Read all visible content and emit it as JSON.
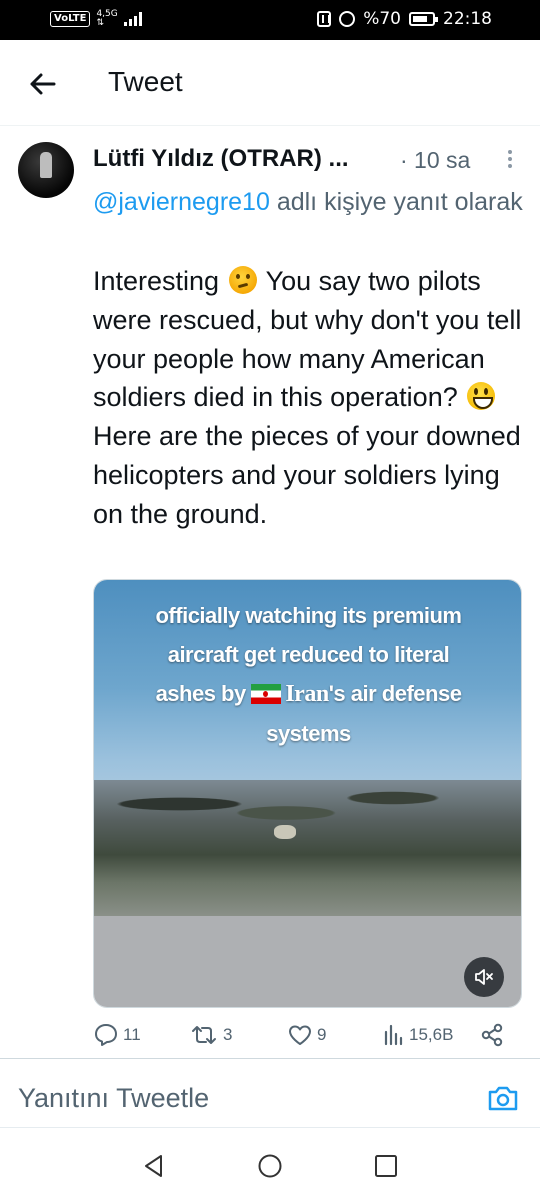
{
  "status_bar": {
    "volte": "VoLTE",
    "network_top": "4,5G",
    "network_bottom": "⇅",
    "battery_percent": "%70",
    "time": "22:18"
  },
  "header": {
    "title": "Tweet"
  },
  "tweet": {
    "author_name": "Lütfi Yıldız (OTRAR) ...",
    "time_ago": "· 10 sa",
    "reply_handle": "@javiernegre10",
    "reply_suffix": " adlı kişiye yanıt olarak",
    "text_part1": "Interesting ",
    "text_part2": " You say two pilots were rescued, but why don't you tell your people how many American soldiers died in this operation? ",
    "text_part3": "Here are the pieces of your downed helicopters and your soldiers lying on the ground.",
    "media": {
      "caption_line1": "officially watching its premium",
      "caption_line2": "aircraft get reduced to literal",
      "caption_pre": "ashes by ",
      "caption_iran": "Iran",
      "caption_post": "'s air defense",
      "caption_line4": "systems",
      "muted_icon": "volume-muted-icon"
    },
    "actions": {
      "replies": "11",
      "retweets": "3",
      "likes": "9",
      "views": "15,6B"
    }
  },
  "reply_bar": {
    "placeholder": "Yanıtını Tweetle"
  },
  "colors": {
    "link": "#1d9bf0",
    "secondary_text": "#536471",
    "primary_text": "#0f1419"
  }
}
